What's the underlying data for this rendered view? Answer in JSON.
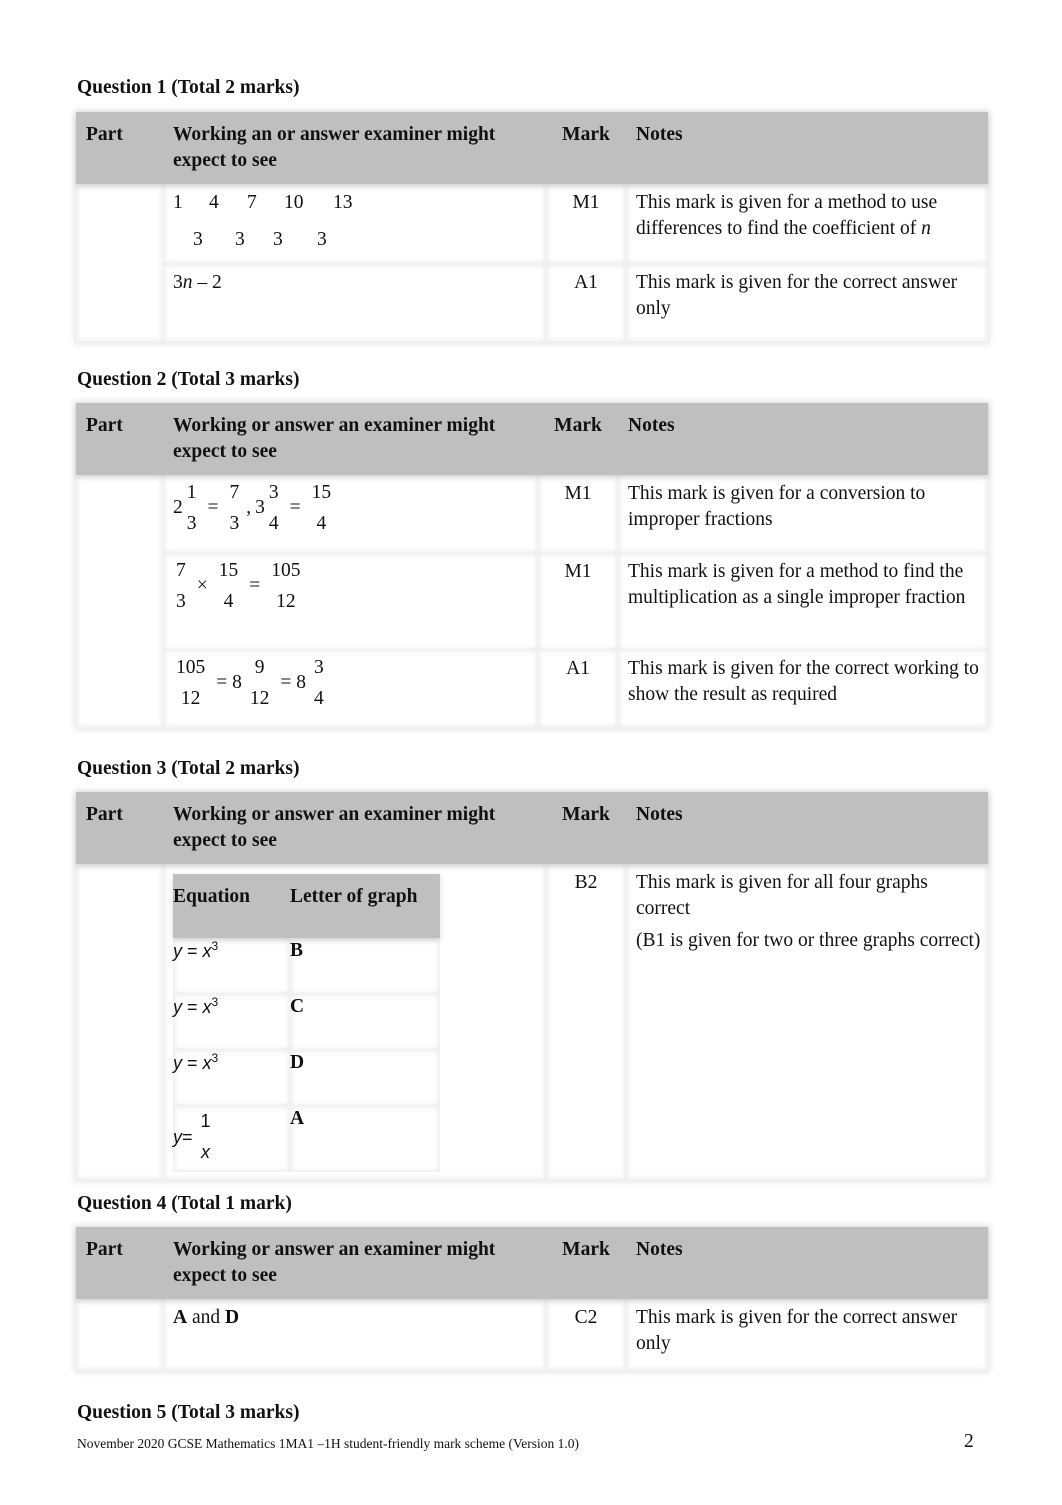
{
  "column_headers": {
    "part": "Part",
    "mark": "Mark",
    "notes": "Notes"
  },
  "q1": {
    "title": "Question 1 (Total 2 marks)",
    "working_header": "Working an or answer examiner might expect to see",
    "rows": [
      {
        "sequence": [
          "1",
          "4",
          "7",
          "10",
          "13"
        ],
        "differences": [
          "3",
          "3",
          "3",
          "3"
        ],
        "mark": "M1",
        "notes_text": "This mark is given for a method to use differences to find the coefficient of ",
        "notes_var": "n"
      },
      {
        "answer_coef": "3",
        "answer_var": "n",
        "answer_rest": " – 2",
        "mark": "A1",
        "notes": "This mark is given for the correct answer only"
      }
    ]
  },
  "q2": {
    "title": "Question 2 (Total 3 marks)",
    "working_header": "Working or answer an examiner might expect to see",
    "rows": [
      {
        "working": {
          "a_whole": "2",
          "a_num": "1",
          "a_den": "3",
          "b_num": "7",
          "b_den": "3",
          "c_whole": "3",
          "c_num": "3",
          "c_den": "4",
          "d_num": "15",
          "d_den": "4",
          "eq": "=",
          "comma": ","
        },
        "mark": "M1",
        "notes": "This mark is given for a conversion to improper fractions"
      },
      {
        "working": {
          "a_num": "7",
          "a_den": "3",
          "times": "×",
          "b_num": "15",
          "b_den": "4",
          "eq": "=",
          "c_num": "105",
          "c_den": "12"
        },
        "mark": "M1",
        "notes": "This mark is given for a method to find the multiplication as a single improper fraction"
      },
      {
        "working": {
          "a_num": "105",
          "a_den": "12",
          "eq1": "= 8",
          "b_num": "9",
          "b_den": "12",
          "eq2": "= 8",
          "c_num": "3",
          "c_den": "4"
        },
        "mark": "A1",
        "notes": "This mark is given for the correct working to show the result as required"
      }
    ]
  },
  "q3": {
    "title": "Question 3 (Total 2 marks)",
    "working_header": "Working or answer an examiner might expect to see",
    "inner_table": {
      "headers": [
        "Equation",
        "Letter of graph"
      ],
      "rows": [
        {
          "eq_y": "y",
          "eq_mid": " = ",
          "eq_x": "x",
          "eq_pow": "3",
          "letter": "B"
        },
        {
          "eq_y": "y",
          "eq_mid": " = ",
          "eq_x": "x",
          "eq_pow": "3",
          "letter": "C"
        },
        {
          "eq_y": "y",
          "eq_mid": " = ",
          "eq_x": "x",
          "eq_pow": "3",
          "letter": "D"
        },
        {
          "eq_y": "y",
          "eq_mid": " = ",
          "frac_num": "1",
          "frac_den": "x",
          "letter": "A"
        }
      ]
    },
    "mark": "B2",
    "notes": [
      "This mark is given for all four graphs correct",
      "(B1 is given for two or three graphs correct)"
    ]
  },
  "q4": {
    "title": "Question 4 (Total 1 mark)",
    "working_header": "Working or answer an examiner might expect to see",
    "answer_a": "A",
    "answer_and": " and ",
    "answer_b": "D",
    "mark": "C2",
    "notes": "This mark is given for the correct answer only"
  },
  "q5": {
    "title": "Question 5 (Total 3 marks)"
  },
  "footer": {
    "text": "November 2020 GCSE Mathematics 1MA1 –1H student-friendly mark scheme (Version 1.0)",
    "page_number": "2"
  }
}
